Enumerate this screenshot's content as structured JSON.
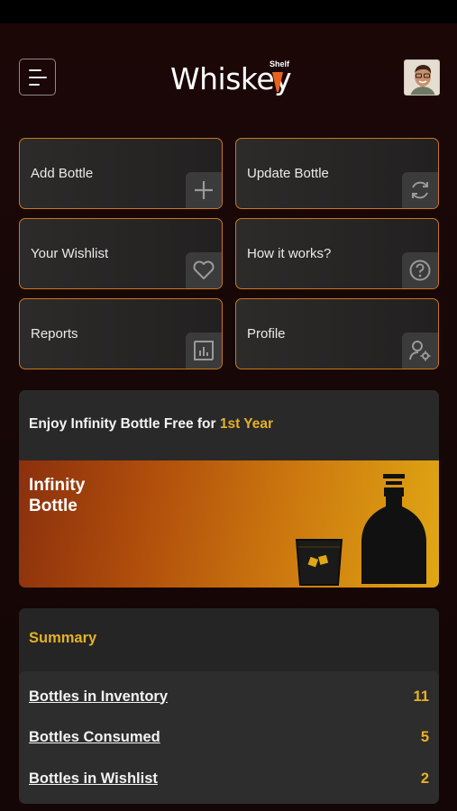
{
  "header": {
    "logo_word": "Whiskey",
    "logo_sub": "Shelf"
  },
  "tiles": [
    {
      "label": "Add Bottle",
      "icon": "plus-icon"
    },
    {
      "label": "Update Bottle",
      "icon": "refresh-icon"
    },
    {
      "label": "Your Wishlist",
      "icon": "heart-icon"
    },
    {
      "label": "How it works?",
      "icon": "question-icon"
    },
    {
      "label": "Reports",
      "icon": "chart-icon"
    },
    {
      "label": "Profile",
      "icon": "user-settings-icon"
    }
  ],
  "promo": {
    "text_prefix": "Enjoy Infinity Bottle Free for ",
    "text_highlight": "1st Year",
    "banner_title_line1": "Infinity",
    "banner_title_line2": "Bottle"
  },
  "summary": {
    "title": "Summary",
    "rows": [
      {
        "label": "Bottles in Inventory",
        "value": "11"
      },
      {
        "label": "Bottles Consumed",
        "value": "5"
      },
      {
        "label": "Bottles in Wishlist",
        "value": "2"
      }
    ]
  },
  "colors": {
    "accent": "#e5b125",
    "tile_border": "#c7781d",
    "background": "#1a0808"
  }
}
